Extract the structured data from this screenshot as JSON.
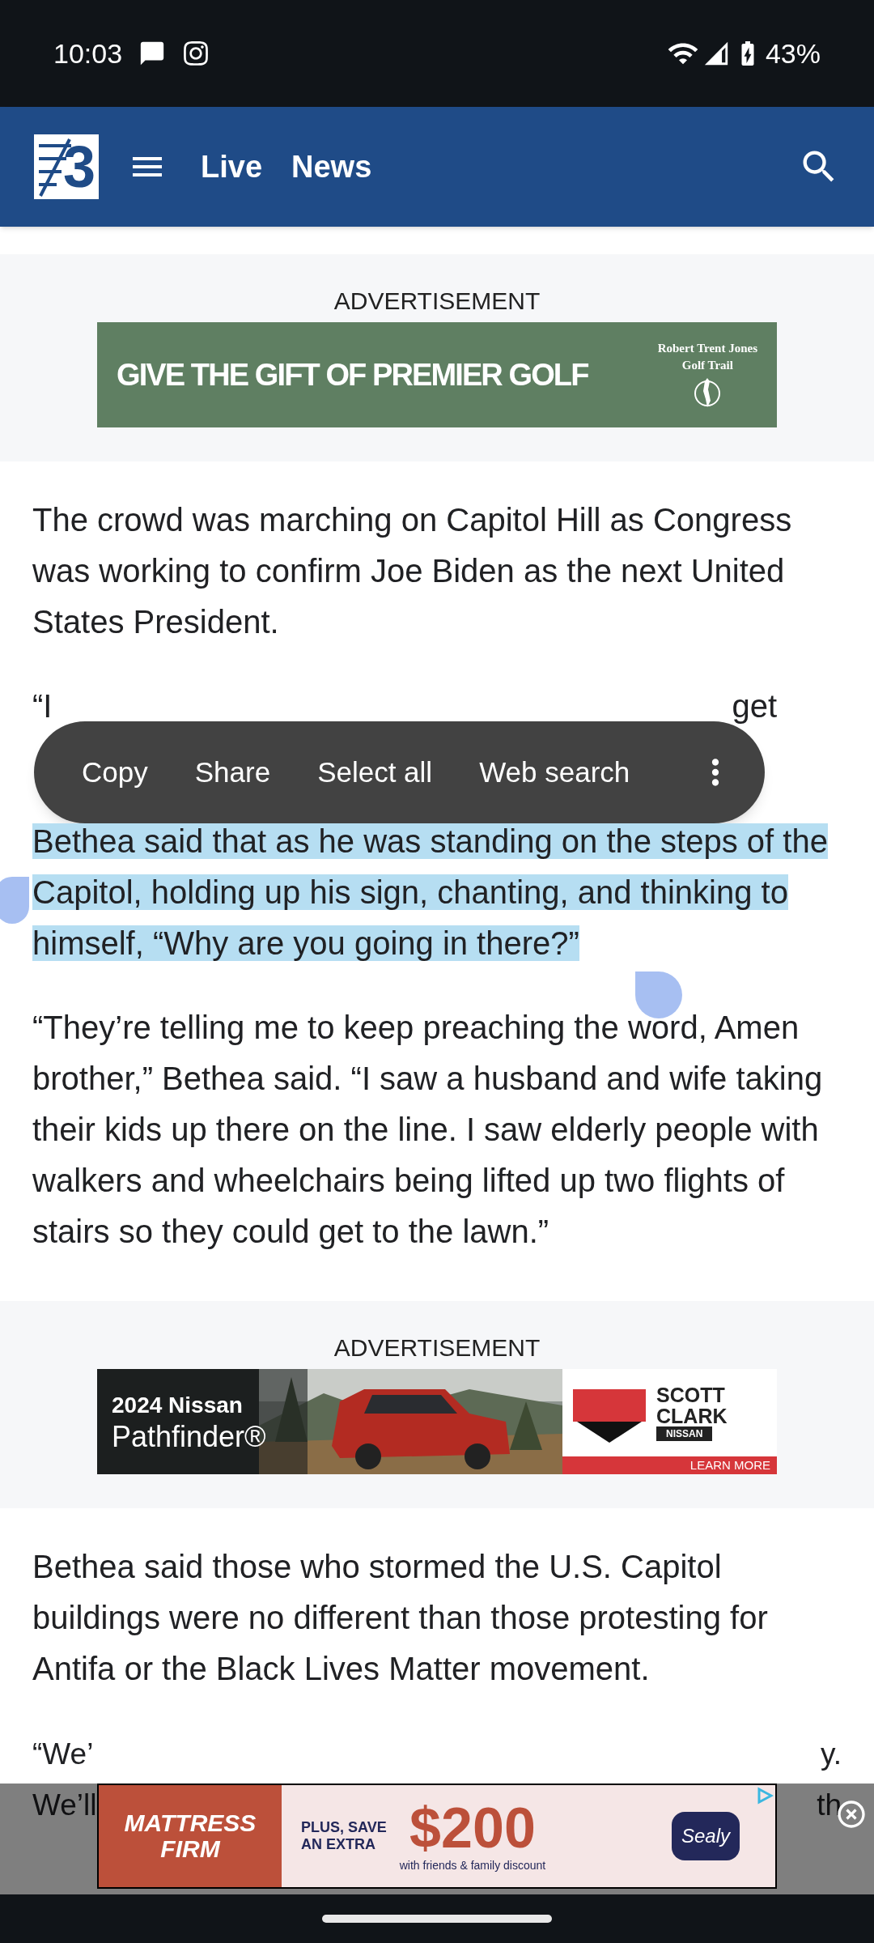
{
  "status_bar": {
    "time": "10:03",
    "battery": "43%"
  },
  "header": {
    "logo": "3",
    "nav": [
      "Live",
      "News"
    ]
  },
  "content": [
    {
      "kind": "golf_ad",
      "label": "ADVERTISEMENT",
      "headline": "GIVE THE GIFT OF PREMIER GOLF",
      "brand": [
        "Robert Trent Jones",
        "Golf Trail"
      ]
    },
    {
      "kind": "paragraph",
      "text": "The crowd was marching on Capitol Hill as Congress was working to confirm Joe Biden as the next United States President.",
      "selected": false
    },
    {
      "kind": "covered",
      "texts": [
        "“I",
        "get"
      ]
    },
    {
      "kind": "paragraph",
      "text": "Bethea said that as he was standing on the steps of the Capitol, holding up his sign, chanting, and thinking to himself, “Why are you going in there?”",
      "selected": true
    },
    {
      "kind": "paragraph",
      "text": "“They’re telling me to keep preaching the word, Amen brother,” Bethea said. “I saw a husband and wife taking their kids up there on the line. I saw elderly people with walkers and wheelchairs being lifted up two flights of stairs so they could get to the lawn.”",
      "selected": false
    },
    {
      "kind": "nissan_ad",
      "label": "ADVERTISEMENT",
      "headline": "2024 Nissan",
      "model": "Pathfinder®",
      "brand": [
        "SCOTT",
        "CLARK"
      ],
      "badge": "NISSAN",
      "cta": "LEARN MORE"
    },
    {
      "kind": "paragraph",
      "text": "Bethea said those who stormed the U.S. Capitol buildings were no different than those protesting for Antifa or the Black Lives Matter movement.",
      "selected": false
    }
  ],
  "selection_toolbar": {
    "actions": [
      "Copy",
      "Share",
      "Select all",
      "Web search"
    ]
  },
  "covered_lines": [
    [
      "“We’",
      "y."
    ],
    [
      "We’ll",
      "th"
    ]
  ],
  "bottom_ad": {
    "brand": [
      "MATTRESS",
      "FIRM"
    ],
    "offer": [
      "PLUS, SAVE",
      "AN EXTRA"
    ],
    "amount": "$200",
    "note": "with friends & family discount",
    "partner": "Sealy"
  }
}
